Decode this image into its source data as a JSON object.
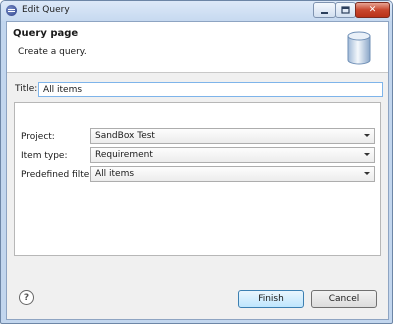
{
  "window": {
    "title": "Edit Query",
    "close_glyph": "✕"
  },
  "header": {
    "title": "Query page",
    "description": "Create a query.",
    "icon": "database-icon"
  },
  "title_field": {
    "label": "Title:",
    "value": "All items"
  },
  "fields": {
    "project": {
      "label": "Project:",
      "value": "SandBox Test"
    },
    "item_type": {
      "label": "Item type:",
      "value": "Requirement"
    },
    "predefined_filter": {
      "label": "Predefined filter:",
      "value": "All items"
    }
  },
  "footer": {
    "help_glyph": "?",
    "finish_label": "Finish",
    "cancel_label": "Cancel"
  }
}
